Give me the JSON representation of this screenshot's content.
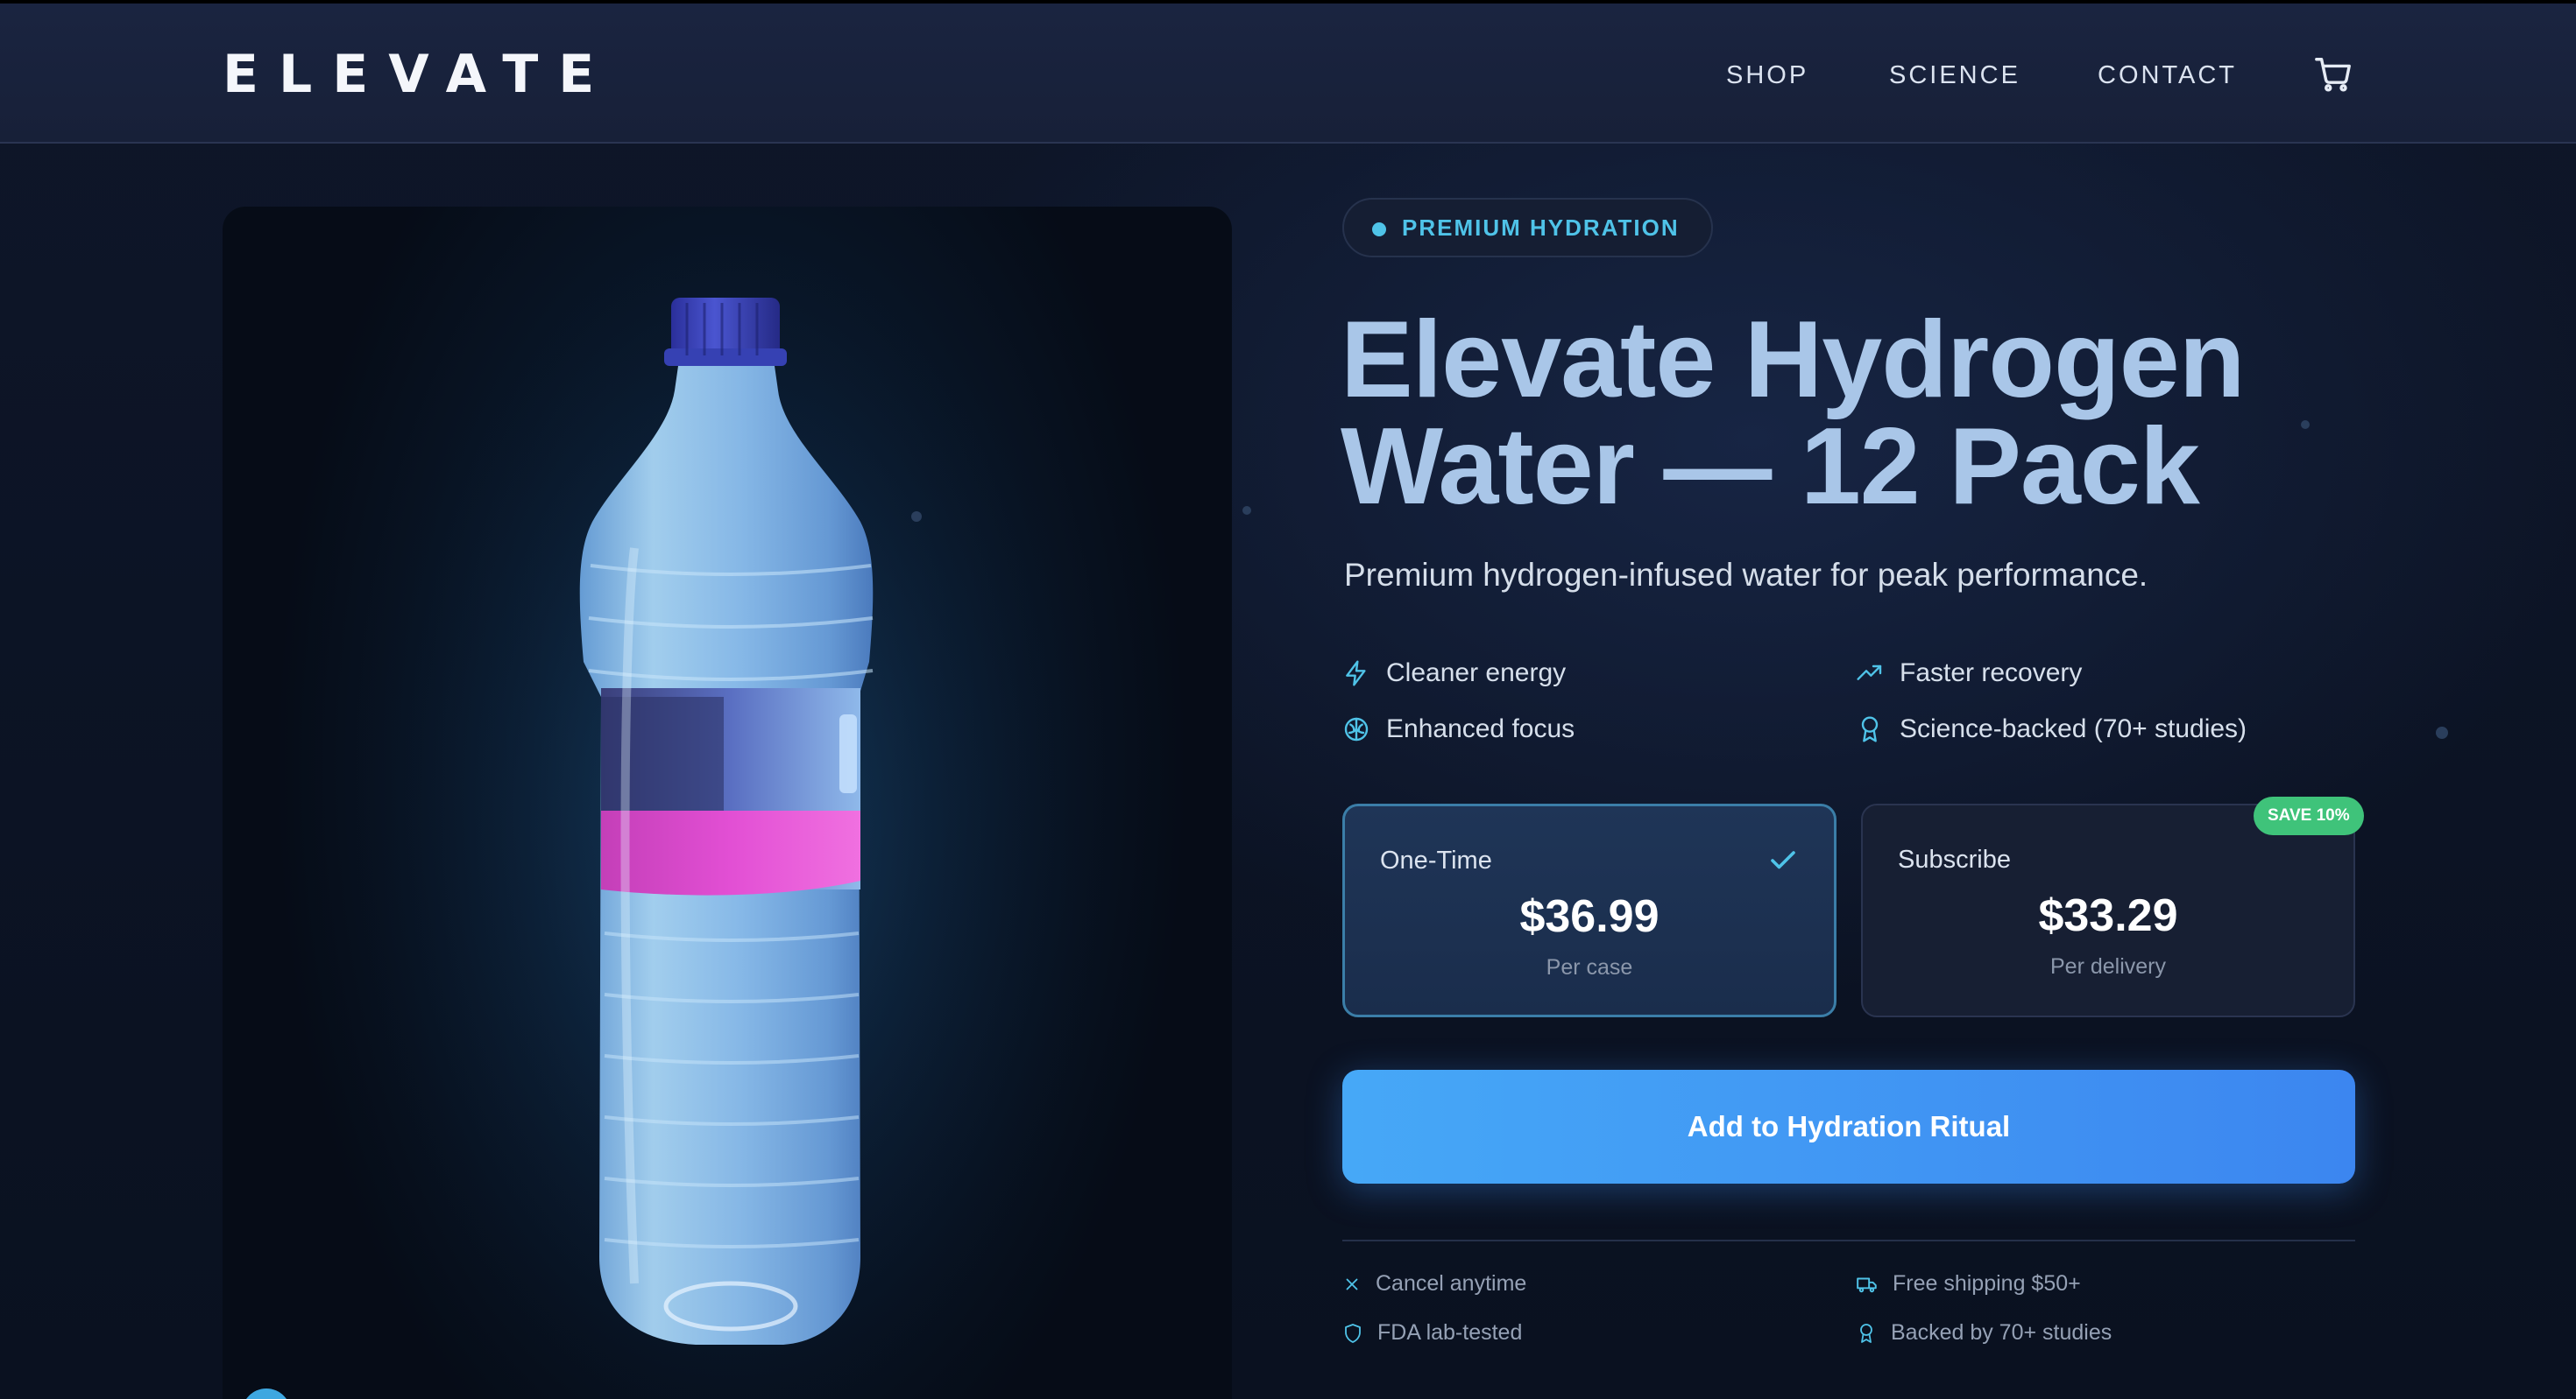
{
  "brand": {
    "logo": "ELEVATE"
  },
  "nav": {
    "links": [
      "SHOP",
      "SCIENCE",
      "CONTACT"
    ],
    "cart_icon": "cart-icon"
  },
  "product": {
    "badge": "PREMIUM HYDRATION",
    "title_line1": "Elevate Hydrogen",
    "title_line2": "Water — 12 Pack",
    "subtitle": "Premium hydrogen-infused water for peak performance.",
    "features": [
      {
        "icon": "lightning-icon",
        "label": "Cleaner energy"
      },
      {
        "icon": "trending-up-icon",
        "label": "Faster recovery"
      },
      {
        "icon": "brain-icon",
        "label": "Enhanced focus"
      },
      {
        "icon": "award-icon",
        "label": "Science-backed (70+ studies)"
      }
    ]
  },
  "pricing": {
    "one_time": {
      "label": "One-Time",
      "price": "$36.99",
      "sub": "Per case",
      "selected": true
    },
    "subscribe": {
      "label": "Subscribe",
      "price": "$33.29",
      "sub": "Per delivery",
      "badge": "SAVE 10%"
    }
  },
  "cta": {
    "label": "Add to Hydration Ritual"
  },
  "trust": [
    {
      "icon": "x-icon",
      "label": "Cancel anytime"
    },
    {
      "icon": "truck-icon",
      "label": "Free shipping $50+"
    },
    {
      "icon": "shield-icon",
      "label": "FDA lab-tested"
    },
    {
      "icon": "award-icon",
      "label": "Backed by 70+ studies"
    }
  ],
  "colors": {
    "accent": "#4fc3e8",
    "title": "#a9c6e8",
    "cta_start": "#46a8f7",
    "cta_end": "#3c86f0",
    "save_badge": "#3fc37a",
    "label_pink": "#d94ac8"
  }
}
